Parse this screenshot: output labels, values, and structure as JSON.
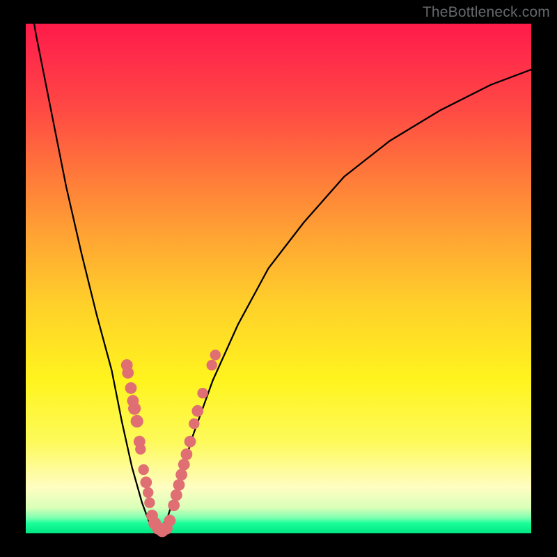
{
  "watermark": "TheBottleneck.com",
  "chart_data": {
    "type": "line",
    "title": "",
    "xlabel": "",
    "ylabel": "",
    "xlim": [
      0,
      100
    ],
    "ylim": [
      0,
      100
    ],
    "series": [
      {
        "name": "curve",
        "x": [
          0,
          2,
          5,
          8,
          11,
          14,
          17,
          19,
          21,
          23,
          24.5,
          26,
          28,
          30,
          33,
          37,
          42,
          48,
          55,
          63,
          72,
          82,
          92,
          100
        ],
        "y": [
          110,
          98,
          83,
          68,
          55,
          43,
          32,
          22,
          13,
          6,
          2,
          0,
          3,
          9,
          19,
          30,
          41,
          52,
          61,
          70,
          77,
          83,
          88,
          91
        ]
      }
    ],
    "markers": [
      {
        "name": "dots",
        "color": "#e06f73",
        "points": [
          {
            "x": 20.0,
            "y": 33.0,
            "r": 1.2
          },
          {
            "x": 20.2,
            "y": 31.5,
            "r": 1.2
          },
          {
            "x": 20.8,
            "y": 28.5,
            "r": 1.2
          },
          {
            "x": 21.2,
            "y": 26.0,
            "r": 1.2
          },
          {
            "x": 21.5,
            "y": 24.5,
            "r": 1.3
          },
          {
            "x": 22.0,
            "y": 22.0,
            "r": 1.3
          },
          {
            "x": 22.5,
            "y": 18.0,
            "r": 1.2
          },
          {
            "x": 22.7,
            "y": 16.5,
            "r": 1.1
          },
          {
            "x": 23.3,
            "y": 12.5,
            "r": 1.1
          },
          {
            "x": 23.8,
            "y": 10.0,
            "r": 1.2
          },
          {
            "x": 24.2,
            "y": 8.0,
            "r": 1.1
          },
          {
            "x": 24.5,
            "y": 6.0,
            "r": 1.1
          },
          {
            "x": 25.0,
            "y": 3.5,
            "r": 1.2
          },
          {
            "x": 25.5,
            "y": 2.0,
            "r": 1.3
          },
          {
            "x": 26.2,
            "y": 1.0,
            "r": 1.3
          },
          {
            "x": 27.0,
            "y": 0.5,
            "r": 1.3
          },
          {
            "x": 27.8,
            "y": 1.0,
            "r": 1.3
          },
          {
            "x": 28.5,
            "y": 2.5,
            "r": 1.2
          },
          {
            "x": 29.3,
            "y": 5.5,
            "r": 1.2
          },
          {
            "x": 29.8,
            "y": 7.5,
            "r": 1.2
          },
          {
            "x": 30.3,
            "y": 9.5,
            "r": 1.2
          },
          {
            "x": 30.8,
            "y": 11.5,
            "r": 1.2
          },
          {
            "x": 31.3,
            "y": 13.5,
            "r": 1.2
          },
          {
            "x": 31.8,
            "y": 15.5,
            "r": 1.2
          },
          {
            "x": 32.5,
            "y": 18.0,
            "r": 1.2
          },
          {
            "x": 33.3,
            "y": 21.5,
            "r": 1.1
          },
          {
            "x": 34.0,
            "y": 24.0,
            "r": 1.2
          },
          {
            "x": 35.0,
            "y": 27.5,
            "r": 1.1
          },
          {
            "x": 36.8,
            "y": 33.0,
            "r": 1.1
          },
          {
            "x": 37.5,
            "y": 35.0,
            "r": 1.1
          }
        ]
      }
    ]
  }
}
